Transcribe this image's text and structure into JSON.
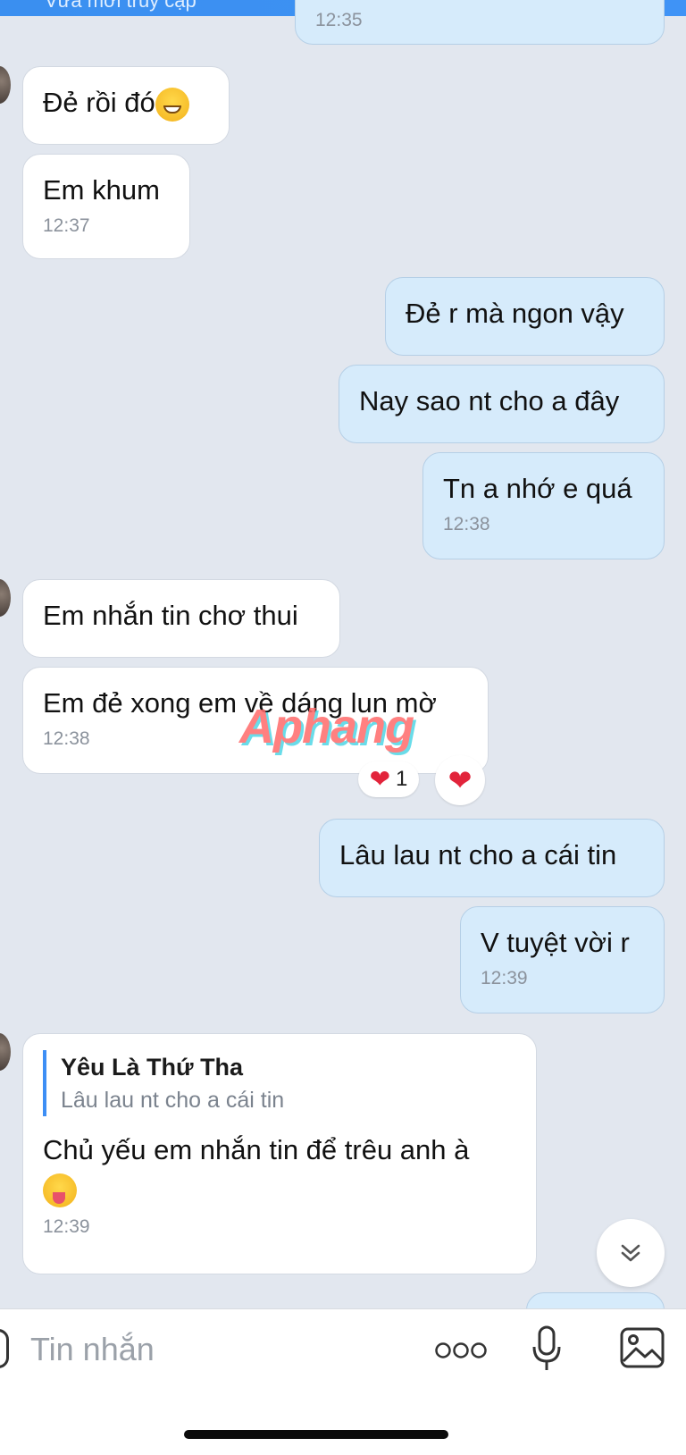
{
  "header": {
    "status_text": "Vừa mới truy cập"
  },
  "messages": [
    {
      "text": "12:35",
      "time": "12:35"
    },
    {
      "text": "Đẻ rồi đó"
    },
    {
      "text": "Em khum",
      "time": "12:37"
    },
    {
      "text": "Đẻ r mà ngon vậy"
    },
    {
      "text": "Nay sao nt cho a đây"
    },
    {
      "text": "Tn a nhớ e quá",
      "time": "12:38"
    },
    {
      "text": "Em nhắn tin chơ thui"
    },
    {
      "text": "Em đẻ xong em về dáng lun mờ",
      "time": "12:38",
      "reaction_count": "1"
    },
    {
      "text": "Lâu lau nt cho a cái tin"
    },
    {
      "text": "V tuyệt vời r",
      "time": "12:39"
    },
    {
      "quote_name": "Yêu Là Thứ Tha",
      "quote_text": "Lâu lau nt cho a cái tin",
      "text": "Chủ yếu em nhắn tin để trêu anh à",
      "time": "12:39"
    }
  ],
  "watermark": "Aphang",
  "composer": {
    "placeholder": "Tin nhắn"
  },
  "icons": [
    "more-dots-icon",
    "microphone-icon",
    "image-icon",
    "chevron-double-down-icon",
    "heart-icon",
    "grin-emoji-icon",
    "wink-tongue-emoji-icon"
  ],
  "colors": {
    "accent": "#3d8ef5",
    "outgoing_bubble": "#d6ebfb",
    "incoming_bubble": "#ffffff",
    "background": "#e2e7ef",
    "heart": "#e2243b"
  }
}
